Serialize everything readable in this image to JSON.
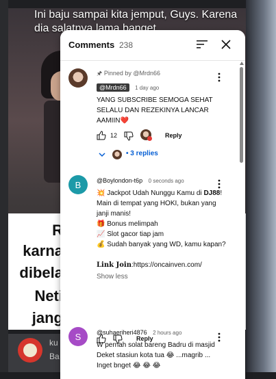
{
  "background": {
    "caption": "Ini baju sampai kita jemput, Guys. Karena dia salatnya lama banget",
    "big_text_lines": [
      "R",
      "karna",
      "dibela",
      "Neti",
      "jang"
    ],
    "bottom_username": "ku",
    "bottom_text": "Ba"
  },
  "panel": {
    "title": "Comments",
    "count": "238"
  },
  "comments": [
    {
      "pinned": "Pinned by @Mrdn66",
      "author": "@Mrdn66",
      "time": "1 day ago",
      "text": "YANG SUBSCRIBE SEMOGA SEHAT SELALU DAN REZEKINYA LANCAR AAMIIN❤️",
      "likes": "12",
      "reply_label": "Reply",
      "replies": "3 replies"
    },
    {
      "avatar_letter": "B",
      "avatar_color": "#1c9aa8",
      "author": "@Boylondon-t6p",
      "time": "0 seconds ago",
      "line1_prefix": "💥 Jackpot Udah Nunggu Kamu di ",
      "line1_bold": "DJ88",
      "line1_suffix": "!",
      "line2": "Main di tempat yang HOKI, bukan yang janji manis!",
      "line3": "🎁 Bonus melimpah",
      "line4": "📈 Slot gacor tiap jam",
      "line5": "💰 Sudah banyak yang WD, kamu kapan?",
      "link_label": "Link Join",
      "link_url": ":https://oncainven.com/",
      "show_less": "Show less",
      "reply_label": "Reply"
    },
    {
      "avatar_letter": "S",
      "avatar_color": "#a64bc6",
      "author": "@suhaeriheri4876",
      "time": "2 hours ago",
      "text": "W pernah solat bareng Badru di masjid Deket stasiun kota tua 😂 ...magrib ... Inget bnget 😂 😂 😂"
    }
  ]
}
